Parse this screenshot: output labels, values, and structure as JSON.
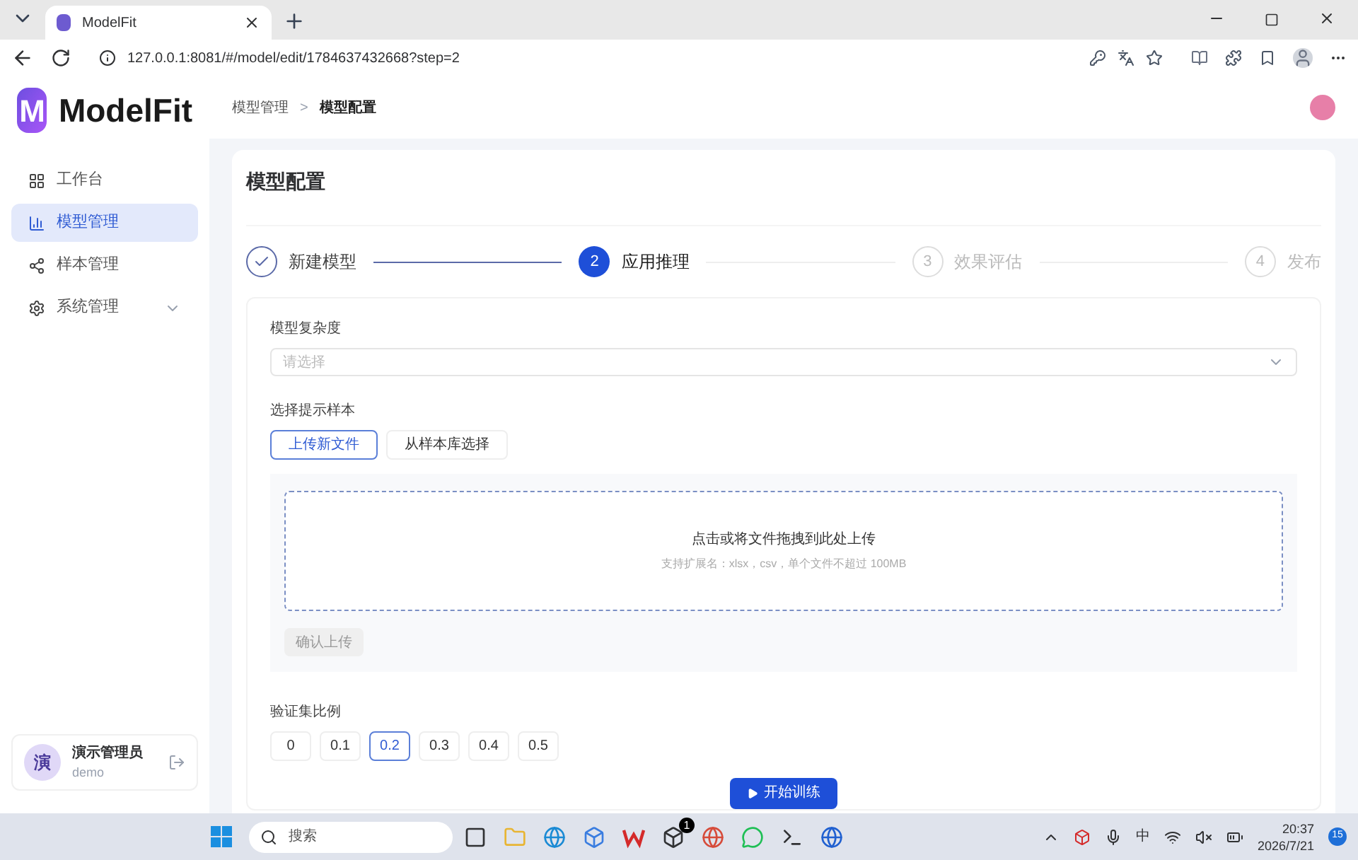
{
  "browser": {
    "tab_title": "ModelFit",
    "url": "127.0.0.1:8081/#/model/edit/1784637432668?step=2"
  },
  "logo": {
    "letter": "M",
    "name": "ModelFit"
  },
  "sidebar": {
    "items": [
      {
        "label": "工作台",
        "kind": "grid",
        "selected": false,
        "expandable": false
      },
      {
        "label": "模型管理",
        "kind": "chart",
        "selected": true,
        "expandable": false
      },
      {
        "label": "样本管理",
        "kind": "dots",
        "selected": false,
        "expandable": false
      },
      {
        "label": "系统管理",
        "kind": "gear",
        "selected": false,
        "expandable": true
      }
    ]
  },
  "user": {
    "avatar": "演",
    "name": "演示管理员",
    "account": "demo"
  },
  "breadcrumb": {
    "items": [
      "模型管理",
      "模型配置"
    ],
    "separator": ">"
  },
  "page_title": "模型配置",
  "steps": [
    {
      "label": "新建模型",
      "completed": true,
      "selected": false
    },
    {
      "number": "2",
      "label": "应用推理",
      "completed": false,
      "selected": true
    },
    {
      "number": "3",
      "label": "效果评估",
      "completed": false,
      "selected": false
    },
    {
      "number": "4",
      "label": "发布",
      "completed": false,
      "selected": false
    }
  ],
  "complexity": {
    "label": "模型复杂度",
    "placeholder": "请选择"
  },
  "sample": {
    "label": "选择提示样本",
    "tabs": [
      {
        "label": "上传新文件",
        "selected": true
      },
      {
        "label": "从样本库选择",
        "selected": false
      }
    ]
  },
  "upload": {
    "title": "点击或将文件拖拽到此处上传",
    "hint": "支持扩展名：xlsx，csv，单个文件不超过 100MB",
    "confirm": {
      "label": "确认上传",
      "disabled": true
    }
  },
  "ratio": {
    "label": "验证集比例",
    "options": [
      {
        "label": "0",
        "selected": false
      },
      {
        "label": "0.1",
        "selected": false
      },
      {
        "label": "0.2",
        "selected": true
      },
      {
        "label": "0.3",
        "selected": false
      },
      {
        "label": "0.4",
        "selected": false
      },
      {
        "label": "0.5",
        "selected": false
      }
    ]
  },
  "start_button": "开始训练",
  "taskbar": {
    "search_placeholder": "搜索",
    "app_badge": "1",
    "ime": "中",
    "time": "20:37",
    "date": "2026/7/21",
    "notifications": "15"
  }
}
